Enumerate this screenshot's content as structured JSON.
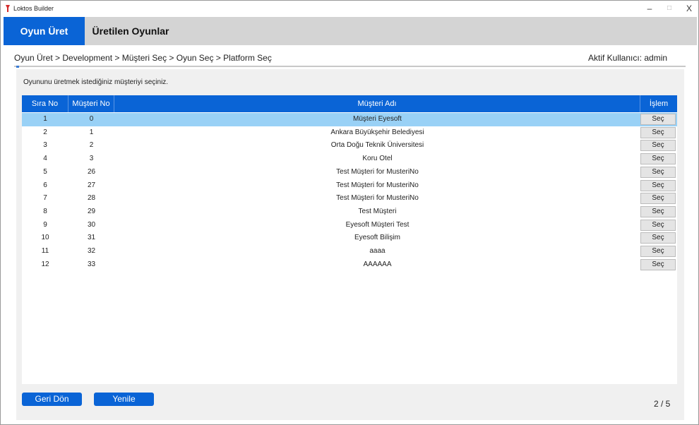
{
  "window": {
    "title": "Loktos Builder",
    "minimize_glyph": "–",
    "maximize_glyph": "□",
    "close_glyph": "X"
  },
  "tabs": {
    "active_label": "Oyun Üret",
    "inactive_label": "Üretilen Oyunlar"
  },
  "header": {
    "breadcrumb": "Oyun Üret  > Development >  Müşteri Seç  >  Oyun Seç  >  Platform Seç",
    "active_user": "Aktif Kullanıcı: admin"
  },
  "main": {
    "instruction": "Oyununu üretmek istediğiniz müşteriyi seçiniz.",
    "columns": [
      "Sıra No",
      "Müşteri No",
      "Müşteri Adı",
      "İşlem"
    ],
    "rows": [
      {
        "sira": "1",
        "musteri_no": "0",
        "musteri_adi": "Müşteri Eyesoft",
        "action": "Seç"
      },
      {
        "sira": "2",
        "musteri_no": "1",
        "musteri_adi": "Ankara Büyükşehir Belediyesi",
        "action": "Seç"
      },
      {
        "sira": "3",
        "musteri_no": "2",
        "musteri_adi": "Orta Doğu Teknik Üniversitesi",
        "action": "Seç"
      },
      {
        "sira": "4",
        "musteri_no": "3",
        "musteri_adi": "Koru Otel",
        "action": "Seç"
      },
      {
        "sira": "5",
        "musteri_no": "26",
        "musteri_adi": "Test Müşteri for MusteriNo",
        "action": "Seç"
      },
      {
        "sira": "6",
        "musteri_no": "27",
        "musteri_adi": "Test Müşteri for MusteriNo",
        "action": "Seç"
      },
      {
        "sira": "7",
        "musteri_no": "28",
        "musteri_adi": "Test Müşteri for MusteriNo",
        "action": "Seç"
      },
      {
        "sira": "8",
        "musteri_no": "29",
        "musteri_adi": "Test Müşteri",
        "action": "Seç"
      },
      {
        "sira": "9",
        "musteri_no": "30",
        "musteri_adi": "Eyesoft Müşteri Test",
        "action": "Seç"
      },
      {
        "sira": "10",
        "musteri_no": "31",
        "musteri_adi": "Eyesoft Bilişim",
        "action": "Seç"
      },
      {
        "sira": "11",
        "musteri_no": "32",
        "musteri_adi": "aaaa",
        "action": "Seç"
      },
      {
        "sira": "12",
        "musteri_no": "33",
        "musteri_adi": "AAAAAA",
        "action": "Seç"
      }
    ],
    "selected_row_index": 0
  },
  "footer": {
    "back_label": "Geri Dön",
    "refresh_label": "Yenile",
    "page_indicator": "2 / 5"
  },
  "colors": {
    "accent": "#0a64d6",
    "selected_row": "#99d1f6",
    "tabbar_bg": "#d4d4d4",
    "panel_bg": "#f0f0f0",
    "icon_red": "#d42a2a"
  },
  "icons": {
    "app": "app-logo-icon"
  }
}
